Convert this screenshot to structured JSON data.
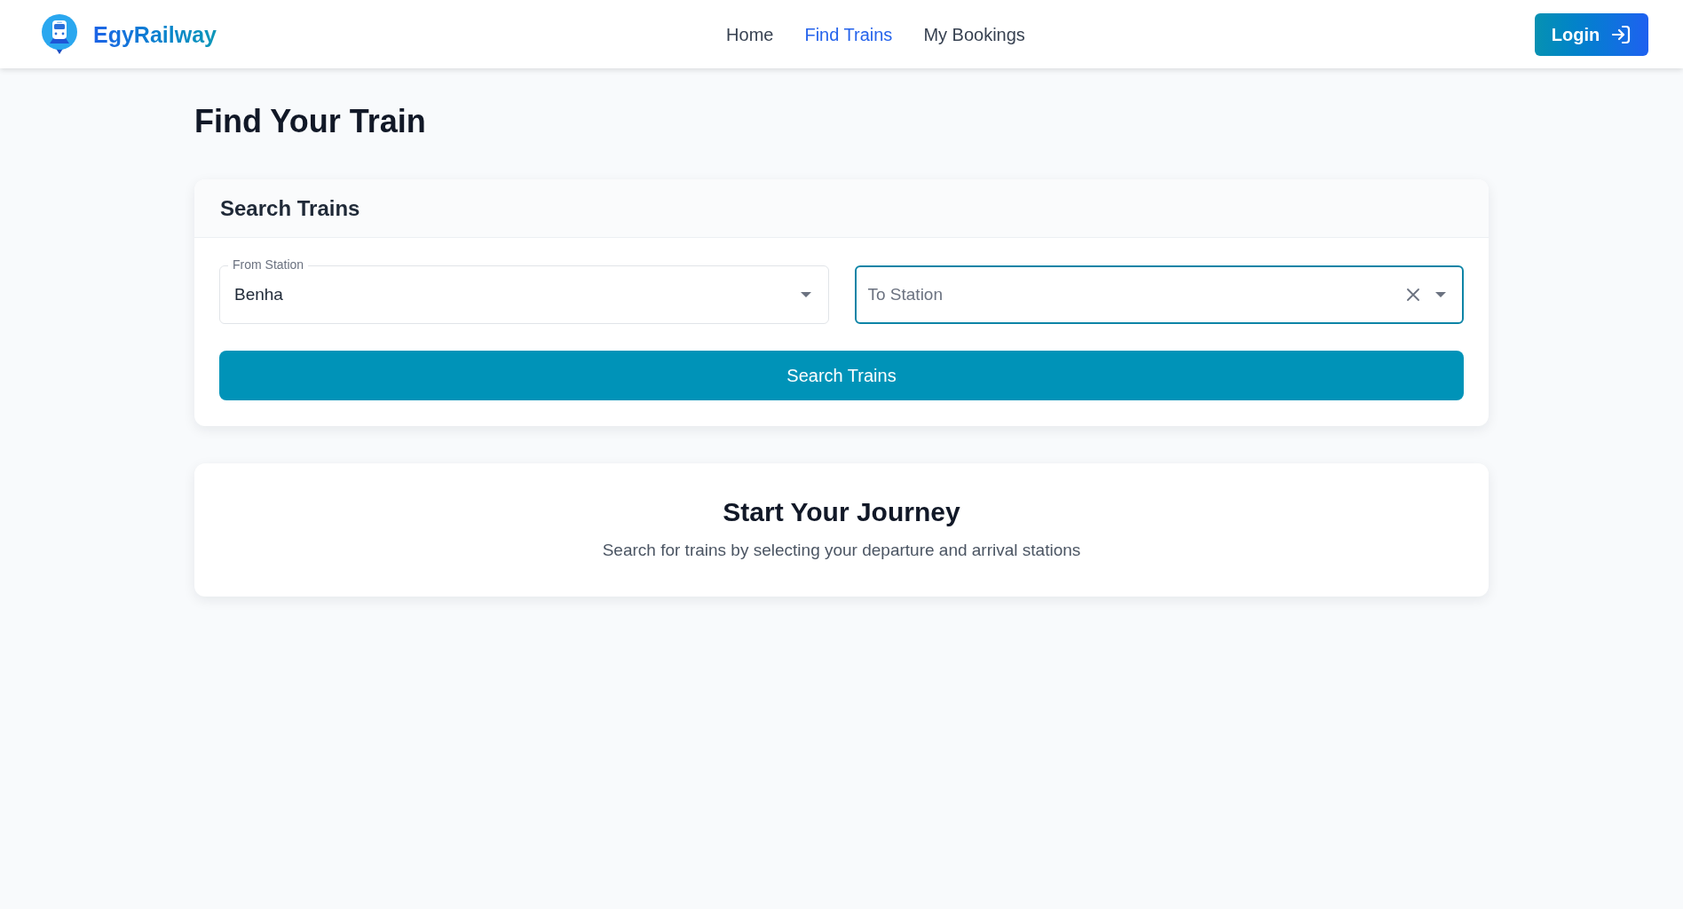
{
  "header": {
    "brand": "EgyRailway",
    "nav": [
      {
        "label": "Home",
        "selected": false
      },
      {
        "label": "Find Trains",
        "selected": true
      },
      {
        "label": "My Bookings",
        "selected": false
      }
    ],
    "login_button": "Login"
  },
  "page_title": "Find Your Train",
  "search_card": {
    "title": "Search Trains",
    "fields": [
      {
        "label": "From Station",
        "value": "Benha",
        "focused": false,
        "clearable": false
      },
      {
        "placeholder": "To Station",
        "focused": true,
        "clearable": true
      }
    ],
    "submit_button": "Search Trains"
  },
  "empty_state": {
    "title": "Start Your Journey",
    "subtitle": "Search for trains by selecting your departure and arrival stations"
  }
}
